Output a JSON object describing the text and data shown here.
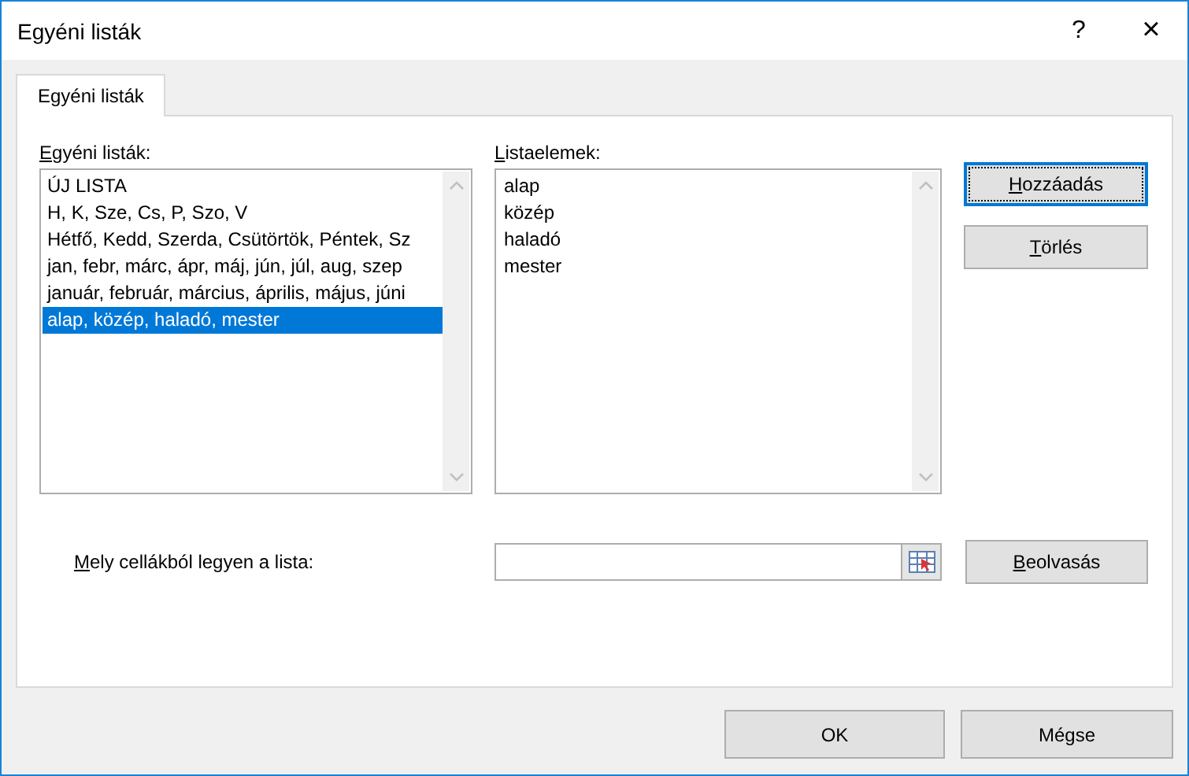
{
  "window": {
    "title": "Egyéni listák",
    "help": "?",
    "close": "×"
  },
  "tabs": [
    {
      "label": "Egyéni listák",
      "selected": true
    }
  ],
  "lists": {
    "label": "Egyéni listák:",
    "items": [
      {
        "text": "ÚJ LISTA",
        "selected": false
      },
      {
        "text": "H, K, Sze, Cs, P, Szo, V",
        "selected": false
      },
      {
        "text": "Hétfő, Kedd, Szerda, Csütörtök, Péntek, Sz",
        "selected": false
      },
      {
        "text": "jan, febr, márc, ápr, máj, jún, júl, aug, szep",
        "selected": false
      },
      {
        "text": "január, február, március, április, május, júni",
        "selected": false
      },
      {
        "text": "alap, közép, haladó, mester",
        "selected": true
      }
    ]
  },
  "entries": {
    "label": "Listaelemek:",
    "items": [
      "alap",
      "közép",
      "haladó",
      "mester"
    ]
  },
  "side_buttons": [
    {
      "label": "Hozzáadás",
      "focused": true
    },
    {
      "label": "Törlés",
      "focused": false
    }
  ],
  "import": {
    "label": "Mely cellákból legyen a lista:",
    "button": "Beolvasás"
  },
  "footer_buttons": [
    "OK",
    "Mégse"
  ]
}
